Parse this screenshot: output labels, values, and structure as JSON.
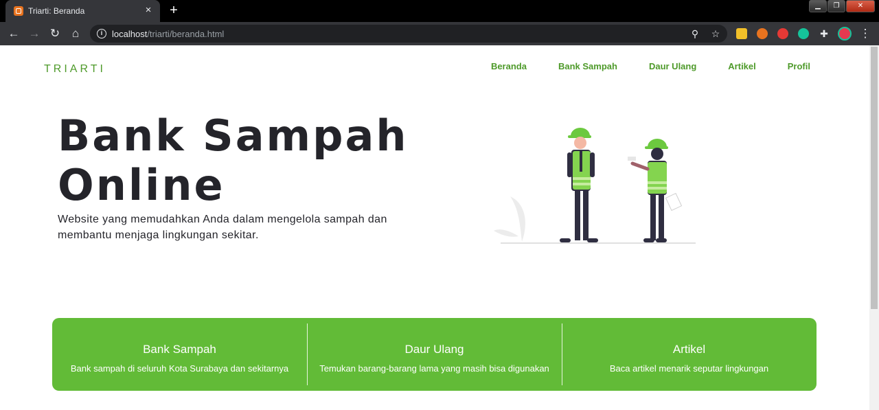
{
  "browser": {
    "tab_title": "Triarti: Beranda",
    "tab_close": "×",
    "new_tab": "+",
    "url_host": "localhost",
    "url_path": "/triarti/beranda.html"
  },
  "site": {
    "brand": "TRIARTI",
    "nav": [
      "Beranda",
      "Bank Sampah",
      "Daur Ulang",
      "Artikel",
      "Profil"
    ]
  },
  "hero": {
    "title_line1": "Bank Sampah",
    "title_line2": "Online",
    "description": "Website yang memudahkan Anda dalam mengelola sampah dan membantu menjaga lingkungan sekitar."
  },
  "features": [
    {
      "title": "Bank Sampah",
      "description": "Bank sampah di seluruh Kota Surabaya dan sekitarnya"
    },
    {
      "title": "Daur Ulang",
      "description": "Temukan barang-barang lama yang masih bisa digunakan"
    },
    {
      "title": "Artikel",
      "description": "Baca artikel menarik seputar lingkungan"
    }
  ],
  "colors": {
    "accent": "#62bb37",
    "brand_text": "#4e9a2a",
    "heading": "#24242a"
  },
  "icons": [
    "back-icon",
    "forward-icon",
    "reload-icon",
    "home-icon",
    "info-icon",
    "zoom-icon",
    "star-icon",
    "extensions-icon",
    "menu-icon"
  ]
}
